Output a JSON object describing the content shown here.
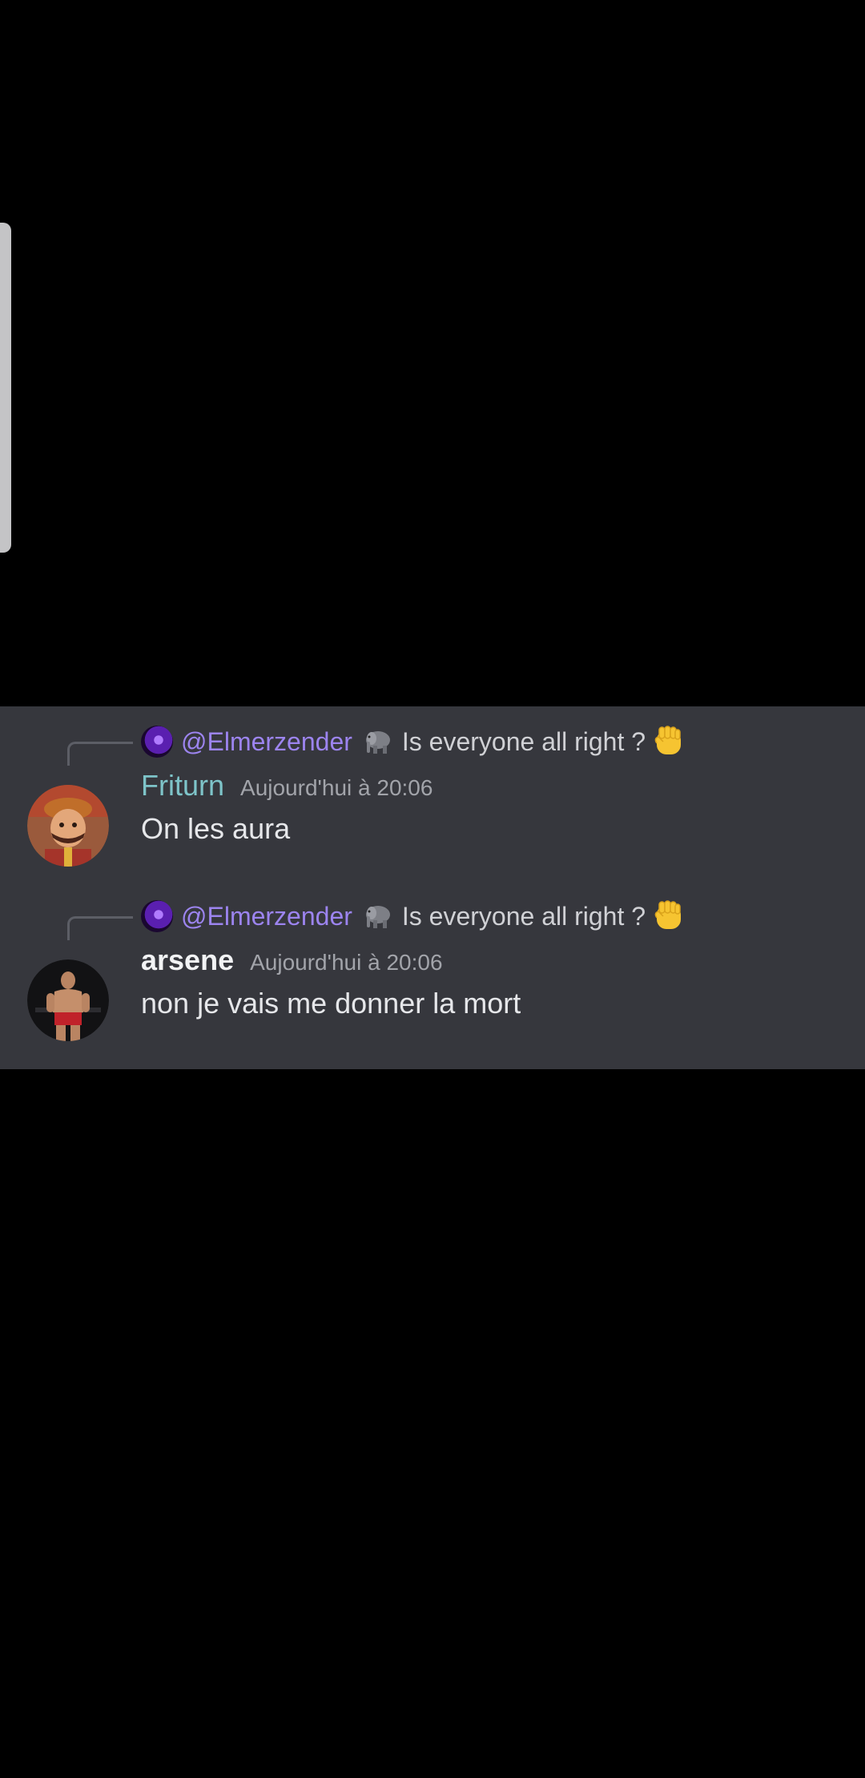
{
  "colors": {
    "background": "#000000",
    "panel": "#36373d",
    "mention": "#9c84ef",
    "username_friturn": "#7ec4c9",
    "username_arsene": "#f2f3f5",
    "timestamp": "#a2a4aa",
    "message_text": "#e6e7ea"
  },
  "messages": [
    {
      "reply": {
        "author": "@Elmerzender",
        "author_avatar_icon": "purple-orb-avatar-icon",
        "elephant_icon": "elephant-emoji-icon",
        "text": "Is everyone all right ?",
        "fist_icon": "raised-fist-emoji-icon"
      },
      "author": "Friturn",
      "timestamp": "Aujourd'hui à 20:06",
      "content": "On les aura",
      "avatar_icon": "cartoon-character-avatar-icon"
    },
    {
      "reply": {
        "author": "@Elmerzender",
        "author_avatar_icon": "purple-orb-avatar-icon",
        "elephant_icon": "elephant-emoji-icon",
        "text": "Is everyone all right ?",
        "fist_icon": "raised-fist-emoji-icon"
      },
      "author": "arsene",
      "timestamp": "Aujourd'hui à 20:06",
      "content": "non je vais me donner la mort",
      "avatar_icon": "fighter-photo-avatar-icon"
    }
  ]
}
